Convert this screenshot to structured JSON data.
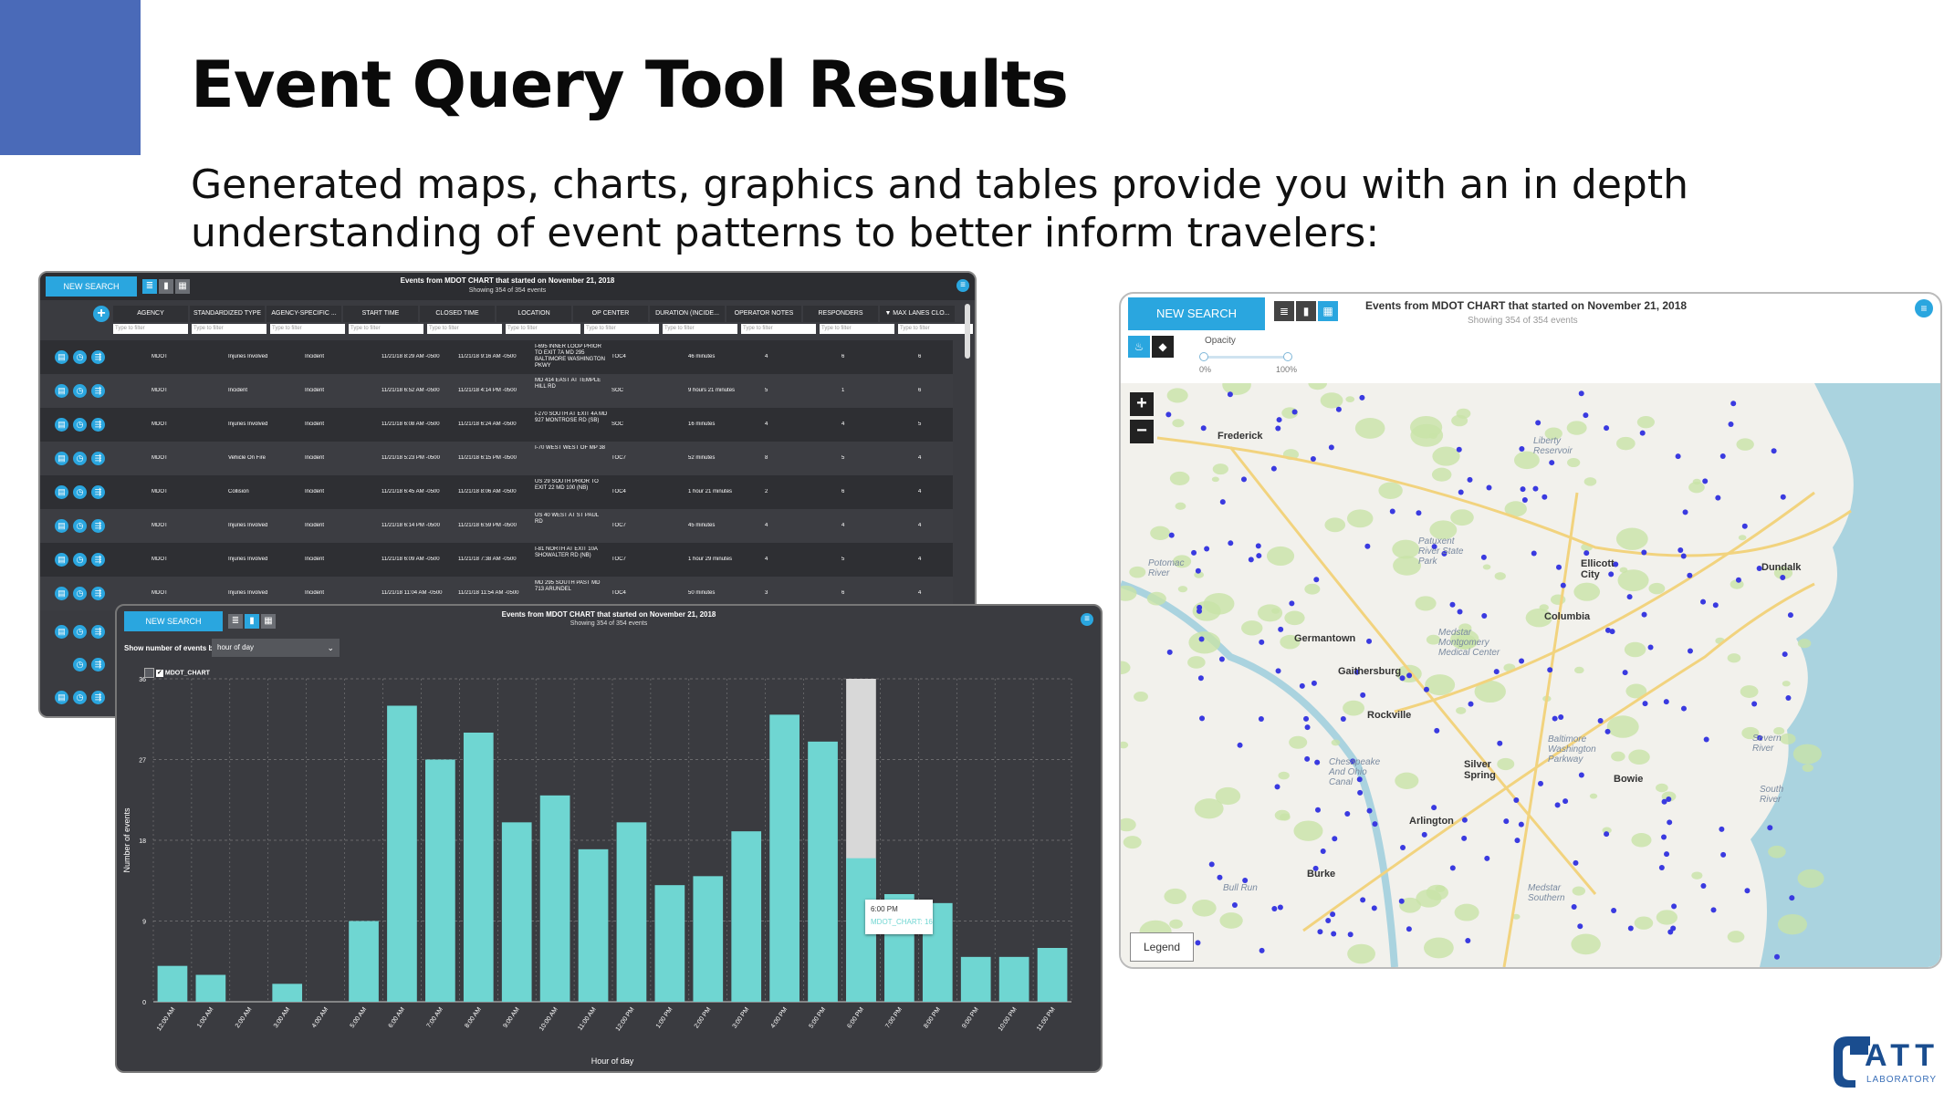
{
  "slide": {
    "title": "Event Query Tool Results",
    "subtitle": "Generated maps, charts, graphics and tables provide you with an in depth understanding of event patterns to better inform travelers:"
  },
  "common": {
    "new_search": "NEW SEARCH",
    "panel_title": "Events from MDOT CHART that started on November 21, 2018",
    "panel_subtitle": "Showing 354 of 354 events"
  },
  "table": {
    "columns": [
      "AGENCY",
      "STANDARDIZED TYPE",
      "AGENCY-SPECIFIC ...",
      "START TIME",
      "CLOSED TIME",
      "LOCATION",
      "OP CENTER",
      "DURATION (INCIDE...",
      "OPERATOR NOTES",
      "RESPONDERS",
      "▼ MAX LANES CLO..."
    ],
    "filter_placeholder": "Type to filter",
    "rows": [
      {
        "agency": "MDOT",
        "type": "Injuries Involved",
        "specific": "Incident",
        "start": "11/21/18 8:29 AM -0500",
        "closed": "11/21/18 9:16 AM -0500",
        "location": "I-695 INNER LOOP PRIOR TO EXIT 7A MD 295 BALTIMORE WASHINGTON PKWY",
        "op": "TOC4",
        "duration": "46 minutes",
        "notes": "4",
        "responders": "6",
        "lanes": "6"
      },
      {
        "agency": "MDOT",
        "type": "Incident",
        "specific": "Incident",
        "start": "11/21/18 6:52 AM -0500",
        "closed": "11/21/18 4:14 PM -0500",
        "location": "MD 414 EAST AT TEMPLE HILL RD",
        "op": "SOC",
        "duration": "9 hours 21 minutes",
        "notes": "5",
        "responders": "1",
        "lanes": "6"
      },
      {
        "agency": "MDOT",
        "type": "Injuries Involved",
        "specific": "Incident",
        "start": "11/21/18 6:08 AM -0500",
        "closed": "11/21/18 6:24 AM -0500",
        "location": "I-270 SOUTH AT EXIT 4A MD 927 MONTROSE RD (SB)",
        "op": "SOC",
        "duration": "16 minutes",
        "notes": "4",
        "responders": "4",
        "lanes": "5"
      },
      {
        "agency": "MDOT",
        "type": "Vehicle On Fire",
        "specific": "Incident",
        "start": "11/21/18 5:23 PM -0500",
        "closed": "11/21/18 6:15 PM -0500",
        "location": "I-70 WEST WEST OF MP 38",
        "op": "TOC7",
        "duration": "52 minutes",
        "notes": "8",
        "responders": "5",
        "lanes": "4"
      },
      {
        "agency": "MDOT",
        "type": "Collision",
        "specific": "Incident",
        "start": "11/21/18 6:45 AM -0500",
        "closed": "11/21/18 8:06 AM -0500",
        "location": "US 29 SOUTH PRIOR TO EXIT 22 MD 100 (NB)",
        "op": "TOC4",
        "duration": "1 hour 21 minutes",
        "notes": "2",
        "responders": "6",
        "lanes": "4"
      },
      {
        "agency": "MDOT",
        "type": "Injuries Involved",
        "specific": "Incident",
        "start": "11/21/18 6:14 PM -0500",
        "closed": "11/21/18 6:59 PM -0500",
        "location": "US 40 WEST AT ST PAUL RD",
        "op": "TOC7",
        "duration": "45 minutes",
        "notes": "4",
        "responders": "4",
        "lanes": "4"
      },
      {
        "agency": "MDOT",
        "type": "Injuries Involved",
        "specific": "Incident",
        "start": "11/21/18 6:09 AM -0500",
        "closed": "11/21/18 7:38 AM -0500",
        "location": "I-81 NORTH AT EXIT 10A SHOWALTER RD (NB)",
        "op": "TOC7",
        "duration": "1 hour 29 minutes",
        "notes": "4",
        "responders": "5",
        "lanes": "4"
      },
      {
        "agency": "MDOT",
        "type": "Injuries Involved",
        "specific": "Incident",
        "start": "11/21/18 11:04 AM -0500",
        "closed": "11/21/18 11:54 AM -0500",
        "location": "MD 295 SOUTH PAST MD 713 ARUNDEL",
        "op": "TOC4",
        "duration": "50 minutes",
        "notes": "3",
        "responders": "6",
        "lanes": "4"
      }
    ]
  },
  "chart_panel": {
    "show_label": "Show number of events by",
    "select_value": "hour of day",
    "legend_series": "MDOT_CHART",
    "tooltip_time": "6:00 PM",
    "tooltip_series": "MDOT_CHART: 16"
  },
  "chart_data": {
    "type": "bar",
    "xlabel": "Hour of day",
    "ylabel": "Number of events",
    "ylim": [
      0,
      36
    ],
    "yticks": [
      0,
      9,
      18,
      27,
      36
    ],
    "categories": [
      "12:00 AM",
      "1:00 AM",
      "2:00 AM",
      "3:00 AM",
      "4:00 AM",
      "5:00 AM",
      "6:00 AM",
      "7:00 AM",
      "8:00 AM",
      "9:00 AM",
      "10:00 AM",
      "11:00 AM",
      "12:00 PM",
      "1:00 PM",
      "2:00 PM",
      "3:00 PM",
      "4:00 PM",
      "5:00 PM",
      "6:00 PM",
      "7:00 PM",
      "8:00 PM",
      "9:00 PM",
      "10:00 PM",
      "11:00 PM"
    ],
    "series": [
      {
        "name": "MDOT_CHART",
        "color": "#6fd6d2",
        "values": [
          4,
          3,
          0,
          2,
          0,
          9,
          33,
          27,
          30,
          20,
          23,
          17,
          20,
          13,
          14,
          19,
          32,
          29,
          16,
          12,
          11,
          5,
          5,
          6
        ]
      }
    ],
    "highlight_category": "6:00 PM",
    "grid": true,
    "legend": "top-left"
  },
  "map": {
    "opacity_label": "Opacity",
    "opacity_min": "0%",
    "opacity_max": "100%",
    "legend_label": "Legend",
    "zoom_in": "+",
    "zoom_out": "−",
    "places": [
      "Frederick",
      "Germantown",
      "Gaithersburg",
      "Rockville",
      "Columbia",
      "Ellicott City",
      "Dundalk",
      "Silver Spring",
      "Bowie",
      "Arlington",
      "Burke"
    ],
    "water_labels": [
      "Potomac River",
      "Patuxent River State Park",
      "Liberty Reservoir",
      "Medstar Montgomery Medical Center",
      "Chesapeake And Ohio Canal",
      "Baltimore Washington Parkway",
      "Severn River",
      "South River",
      "Bull Run",
      "Medstar Southern"
    ]
  },
  "colors": {
    "accent": "#4a6ab8",
    "button": "#2aa6df",
    "panel": "#3a3b40",
    "bar": "#6fd6d2",
    "event_dot": "#3a3ae0"
  },
  "logo": {
    "text": "CATT",
    "subtext": "LABORATORY"
  }
}
